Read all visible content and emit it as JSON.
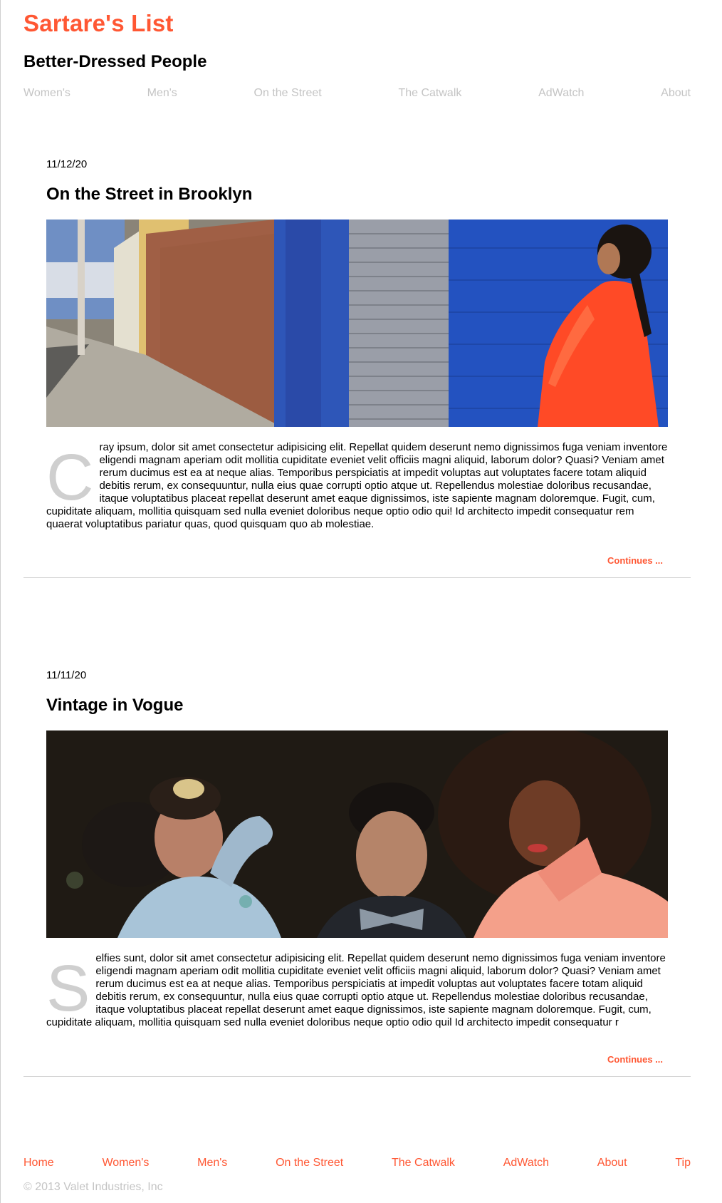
{
  "site": {
    "title": "Sartare's List",
    "subtitle": "Better-Dressed People",
    "accent_color": "#ff5733"
  },
  "top_nav": [
    "Women's",
    "Men's",
    "On the Street",
    "The Catwalk",
    "AdWatch",
    "About"
  ],
  "posts": [
    {
      "date": "11/12/20",
      "title": "On the Street in Brooklyn",
      "image_name": "brooklyn-street-photo",
      "dropcap": "C",
      "body": "ray ipsum, dolor sit amet consectetur adipisicing elit. Repellat quidem deserunt nemo dignissimos fuga veniam inventore eligendi magnam aperiam odit mollitia cupiditate eveniet velit officiis magni aliquid, laborum dolor? Quasi? Veniam amet rerum ducimus est ea at neque alias. Temporibus perspiciatis at impedit voluptas aut voluptates facere totam aliquid debitis rerum, ex consequuntur, nulla eius quae corrupti optio atque ut. Repellendus molestiae doloribus recusandae, itaque voluptatibus placeat repellat deserunt amet eaque dignissimos, iste sapiente magnam doloremque. Fugit, cum, cupiditate aliquam, mollitia quisquam sed nulla eveniet doloribus neque optio odio qui! Id architecto impedit consequatur rem quaerat voluptatibus pariatur quas, quod quisquam quo ab molestiae.",
      "continues": "Continues ..."
    },
    {
      "date": "11/11/20",
      "title": "Vintage in Vogue",
      "image_name": "vintage-party-photo",
      "dropcap": "S",
      "body": "elfies sunt, dolor sit amet consectetur adipisicing elit. Repellat quidem deserunt nemo dignissimos fuga veniam inventore eligendi magnam aperiam odit mollitia cupiditate eveniet velit officiis magni aliquid, laborum dolor? Quasi? Veniam amet rerum ducimus est ea at neque alias. Temporibus perspiciatis at impedit voluptas aut voluptates facere totam aliquid debitis rerum, ex consequuntur, nulla eius quae corrupti optio atque ut. Repellendus molestiae doloribus recusandae, itaque voluptatibus placeat repellat deserunt amet eaque dignissimos, iste sapiente magnam doloremque. Fugit, cum, cupiditate aliquam, mollitia quisquam sed nulla eveniet doloribus neque optio odio quil Id architecto impedit consequatur r",
      "continues": "Continues ..."
    }
  ],
  "bottom_nav": [
    "Home",
    "Women's",
    "Men's",
    "On the Street",
    "The Catwalk",
    "AdWatch",
    "About",
    "Tip"
  ],
  "copyright": "© 2013 Valet Industries, Inc"
}
